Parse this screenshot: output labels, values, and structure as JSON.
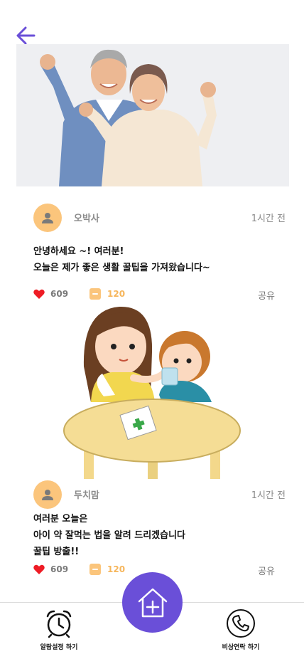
{
  "posts": [
    {
      "author": "오박사",
      "time": "1시간 전",
      "lines": [
        "안녕하세요 ~! 여러분!",
        "오늘은 제가 좋은 생활 꿀팁을 가져왔습니다~"
      ],
      "likes": "609",
      "comments": "120",
      "share": "공유"
    },
    {
      "author": "두치맘",
      "time": "1시간 전",
      "lines": [
        "여러분 오늘은",
        "아이 약 잘먹는 법을 알려 드리겠습니다",
        "꿀팁 방출!!"
      ],
      "likes": "609",
      "comments": "120",
      "share": "공유"
    }
  ],
  "bottom_nav": {
    "alarm_label": "알람설정 하기",
    "emergency_label": "비상연락 하기"
  },
  "colors": {
    "accent": "#6a4fd8",
    "avatar": "#fbc57c",
    "heart": "#ee1c25",
    "comment": "#f6b65c"
  },
  "icons": [
    "back-arrow-icon",
    "user-icon",
    "heart-icon",
    "comment-icon",
    "alarm-clock-icon",
    "home-plus-icon",
    "phone-icon"
  ]
}
